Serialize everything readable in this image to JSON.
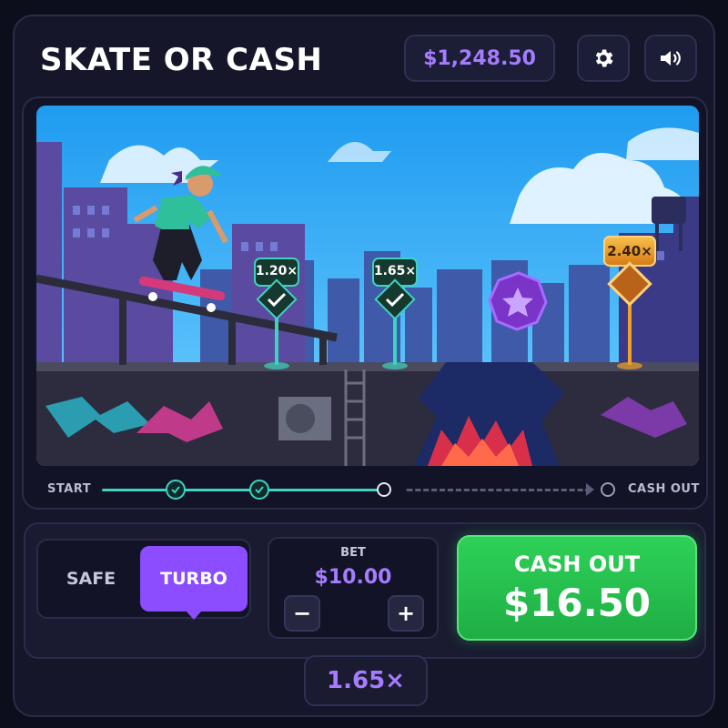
{
  "header": {
    "title": "SKATE OR CASH",
    "balance": "$1,248.50",
    "settings_icon": "gear-icon",
    "sound_icon": "speaker-icon"
  },
  "scene": {
    "checkpoints": [
      {
        "label": "1.20×",
        "state": "passed"
      },
      {
        "label": "1.65×",
        "state": "passed"
      },
      {
        "label": "2.40×",
        "state": "next"
      }
    ],
    "bonus_icon": "star-coin-icon"
  },
  "track": {
    "start_label": "START",
    "end_label": "CASH OUT",
    "nodes": [
      "passed",
      "passed",
      "current",
      "end"
    ]
  },
  "mode": {
    "options": [
      "SAFE",
      "TURBO"
    ],
    "selected": "TURBO"
  },
  "bet": {
    "label": "BET",
    "value": "$10.00",
    "decrease": "−",
    "increase": "+"
  },
  "cashout": {
    "label": "CASH OUT",
    "amount": "$16.50"
  },
  "current_multiplier": "1.65×",
  "colors": {
    "accent": "#8b4dff",
    "balance_text": "#a57cff",
    "cashout": "#2ed157",
    "checkpoint_passed": "#3fd2c0",
    "checkpoint_next": "#f0a02c"
  }
}
